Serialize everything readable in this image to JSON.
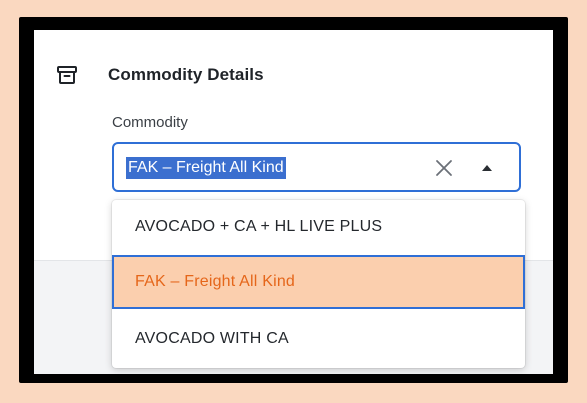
{
  "section": {
    "title": "Commodity Details",
    "icon": "archive-icon"
  },
  "commodity_field": {
    "label": "Commodity",
    "selected_value": "FAK – Freight All Kind",
    "clear_icon": "close-icon",
    "toggle_icon": "caret-up-icon"
  },
  "dropdown": {
    "options": [
      {
        "label": "AVOCADO + CA + HL LIVE PLUS",
        "selected": false
      },
      {
        "label": "FAK – Freight All Kind",
        "selected": true
      },
      {
        "label": "AVOCADO WITH CA",
        "selected": false
      }
    ]
  },
  "colors": {
    "background": "#fad8c0",
    "frame": "#000000",
    "accent_blue": "#2f6fd6",
    "text_highlight": "#3b6fcf",
    "selected_option_bg": "#fbcfae",
    "selected_option_text": "#e5661a"
  }
}
